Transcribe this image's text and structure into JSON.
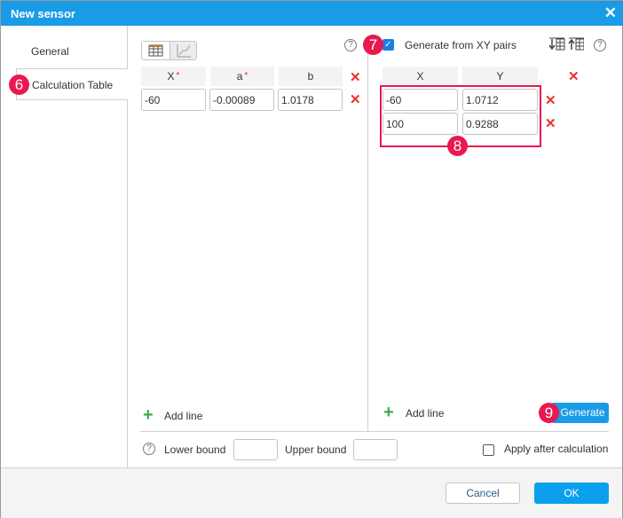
{
  "window": {
    "title": "New sensor",
    "close_icon": "close-icon"
  },
  "sidebar": {
    "tabs": [
      {
        "label": "General"
      },
      {
        "label": "Calculation Table"
      }
    ]
  },
  "badges": {
    "b6": "6",
    "b7": "7",
    "b8": "8",
    "b9": "9"
  },
  "left_table": {
    "headers": [
      {
        "label": "X",
        "required": "*"
      },
      {
        "label": "a",
        "required": "*"
      },
      {
        "label": "b"
      }
    ],
    "rows": [
      [
        "-60",
        "-0.00089",
        "1.0178"
      ]
    ],
    "add_line": "Add line"
  },
  "right_table": {
    "generate_label": "Generate from XY pairs",
    "generate_checked": true,
    "headers": [
      "X",
      "Y"
    ],
    "rows": [
      [
        "-60",
        "1.0712"
      ],
      [
        "100",
        "0.9288"
      ]
    ],
    "add_line": "Add line",
    "generate_button": "Generate"
  },
  "bounds": {
    "lower_label": "Lower bound",
    "lower_value": "",
    "upper_label": "Upper bound",
    "upper_value": "",
    "apply_label": "Apply after calculation",
    "apply_checked": false
  },
  "footer": {
    "cancel": "Cancel",
    "ok": "OK"
  },
  "colors": {
    "accent": "#1a9be6",
    "badge": "#e8194f",
    "delete": "#e8322f",
    "add": "#3fae49"
  }
}
